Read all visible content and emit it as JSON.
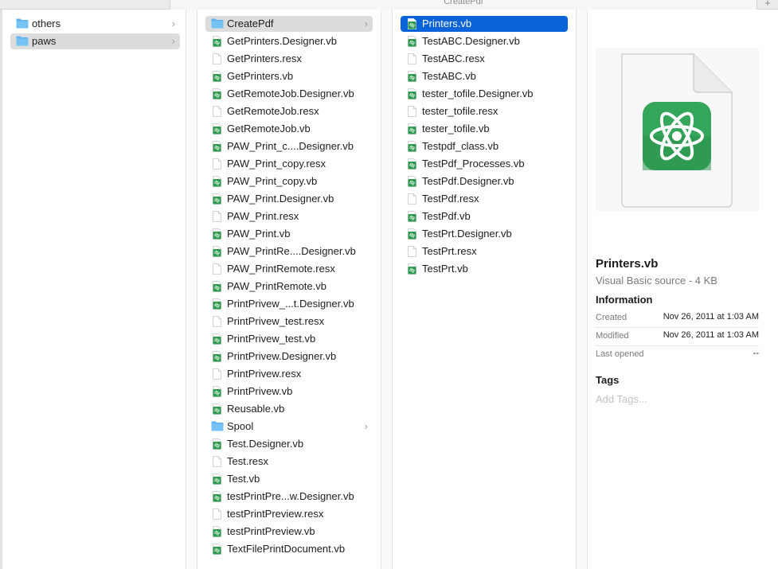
{
  "window": {
    "title": "CreatePdf",
    "add_tab": "+"
  },
  "columns": [
    {
      "items": [
        {
          "name": "others",
          "kind": "folder",
          "has_children": true,
          "selected": "none"
        },
        {
          "name": "paws",
          "kind": "folder",
          "has_children": true,
          "selected": "grey"
        }
      ]
    },
    {
      "items": [
        {
          "name": "CreatePdf",
          "kind": "folder",
          "has_children": true,
          "selected": "grey"
        },
        {
          "name": "GetPrinters.Designer.vb",
          "kind": "vb"
        },
        {
          "name": "GetPrinters.resx",
          "kind": "doc"
        },
        {
          "name": "GetPrinters.vb",
          "kind": "vb"
        },
        {
          "name": "GetRemoteJob.Designer.vb",
          "kind": "vb"
        },
        {
          "name": "GetRemoteJob.resx",
          "kind": "doc"
        },
        {
          "name": "GetRemoteJob.vb",
          "kind": "vb"
        },
        {
          "name": "PAW_Print_c....Designer.vb",
          "kind": "vb"
        },
        {
          "name": "PAW_Print_copy.resx",
          "kind": "doc"
        },
        {
          "name": "PAW_Print_copy.vb",
          "kind": "vb"
        },
        {
          "name": "PAW_Print.Designer.vb",
          "kind": "vb"
        },
        {
          "name": "PAW_Print.resx",
          "kind": "doc"
        },
        {
          "name": "PAW_Print.vb",
          "kind": "vb"
        },
        {
          "name": "PAW_PrintRe....Designer.vb",
          "kind": "vb"
        },
        {
          "name": "PAW_PrintRemote.resx",
          "kind": "doc"
        },
        {
          "name": "PAW_PrintRemote.vb",
          "kind": "vb"
        },
        {
          "name": "PrintPrivew_...t.Designer.vb",
          "kind": "vb"
        },
        {
          "name": "PrintPrivew_test.resx",
          "kind": "doc"
        },
        {
          "name": "PrintPrivew_test.vb",
          "kind": "vb"
        },
        {
          "name": "PrintPrivew.Designer.vb",
          "kind": "vb"
        },
        {
          "name": "PrintPrivew.resx",
          "kind": "doc"
        },
        {
          "name": "PrintPrivew.vb",
          "kind": "vb"
        },
        {
          "name": "Reusable.vb",
          "kind": "vb"
        },
        {
          "name": "Spool",
          "kind": "folder",
          "has_children": true
        },
        {
          "name": "Test.Designer.vb",
          "kind": "vb"
        },
        {
          "name": "Test.resx",
          "kind": "doc"
        },
        {
          "name": "Test.vb",
          "kind": "vb"
        },
        {
          "name": "testPrintPre...w.Designer.vb",
          "kind": "vb"
        },
        {
          "name": "testPrintPreview.resx",
          "kind": "doc"
        },
        {
          "name": "testPrintPreview.vb",
          "kind": "vb"
        },
        {
          "name": "TextFilePrintDocument.vb",
          "kind": "vb"
        }
      ]
    },
    {
      "items": [
        {
          "name": "Printers.vb",
          "kind": "vb",
          "selected": "blue"
        },
        {
          "name": "TestABC.Designer.vb",
          "kind": "vb"
        },
        {
          "name": "TestABC.resx",
          "kind": "doc"
        },
        {
          "name": "TestABC.vb",
          "kind": "vb"
        },
        {
          "name": "tester_tofile.Designer.vb",
          "kind": "vb"
        },
        {
          "name": "tester_tofile.resx",
          "kind": "doc"
        },
        {
          "name": "tester_tofile.vb",
          "kind": "vb"
        },
        {
          "name": "Testpdf_class.vb",
          "kind": "vb"
        },
        {
          "name": "TestPdf_Processes.vb",
          "kind": "vb"
        },
        {
          "name": "TestPdf.Designer.vb",
          "kind": "vb"
        },
        {
          "name": "TestPdf.resx",
          "kind": "doc"
        },
        {
          "name": "TestPdf.vb",
          "kind": "vb"
        },
        {
          "name": "TestPrt.Designer.vb",
          "kind": "vb"
        },
        {
          "name": "TestPrt.resx",
          "kind": "doc"
        },
        {
          "name": "TestPrt.vb",
          "kind": "vb"
        }
      ]
    }
  ],
  "preview": {
    "icon": "atom-app-icon",
    "file_name": "Printers.vb",
    "kind_size": "Visual Basic source - 4 KB",
    "information_heading": "Information",
    "created_label": "Created",
    "created_value": "Nov 26, 2011 at 1:03 AM",
    "modified_label": "Modified",
    "modified_value": "Nov 26, 2011 at 1:03 AM",
    "last_opened_label": "Last opened",
    "last_opened_value": "--",
    "tags_heading": "Tags",
    "tags_placeholder": "Add Tags..."
  },
  "colors": {
    "selection_blue": "#0a63d8",
    "selection_grey": "#dcdcdc",
    "folder_blue": "#5eb4f0",
    "vb_green": "#2e9a50"
  }
}
